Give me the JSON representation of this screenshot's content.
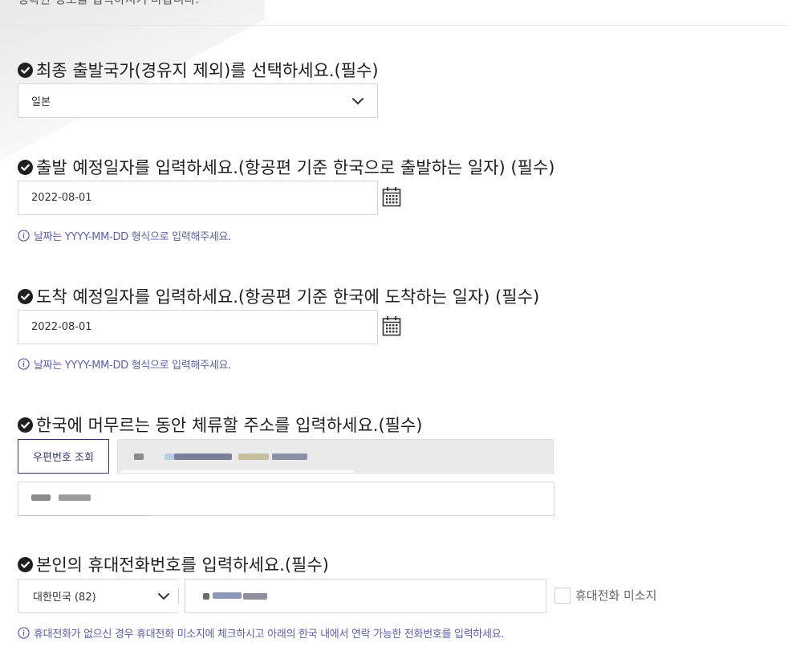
{
  "header": {
    "intro_text": "정확한 정보를 입력하시기 바랍니다."
  },
  "departure_country": {
    "title": "최종 출발국가(경유지 제외)를 선택하세요.(필수)",
    "selected": "일본"
  },
  "departure_date": {
    "title": "출발 예정일자를 입력하세요.(항공편 기준 한국으로 출발하는 일자) (필수)",
    "value": "2022-08-01",
    "hint": "날짜는 YYYY-MM-DD 형식으로 입력해주세요."
  },
  "arrival_date": {
    "title": "도착 예정일자를 입력하세요.(항공편 기준 한국에 도착하는 일자) (필수)",
    "value": "2022-08-01",
    "hint": "날짜는 YYYY-MM-DD 형식으로 입력해주세요."
  },
  "address": {
    "title": "한국에 머무르는 동안 체류할 주소를 입력하세요.(필수)",
    "zip_button": "우편번호 조회"
  },
  "phone": {
    "title": "본인의 휴대전화번호를 입력하세요.(필수)",
    "country_code": "대한민국 (82)",
    "no_phone_label": "휴대전화 미소지",
    "hint": "휴대전화가 없으신 경우 휴대전화 미소지에 체크하시고 아래의 한국 내에서 연락 가능한 전화번호를 입력하세요."
  },
  "colors": {
    "accent": "#30396a",
    "hint": "#5a5fa8",
    "border": "#d7d7d7",
    "readonly_bg": "#eaeaea"
  },
  "icons": [
    "check-circle-icon",
    "chevron-down-icon",
    "calendar-icon",
    "info-icon"
  ]
}
